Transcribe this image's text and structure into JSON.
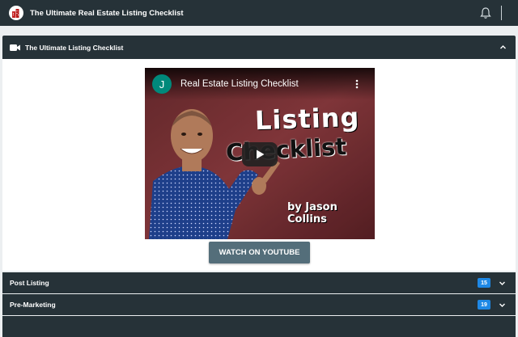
{
  "app": {
    "title": "The Ultimate Real Estate Listing Checklist",
    "logo_icon": "house-logo-icon"
  },
  "header_icons": [
    "bell-icon"
  ],
  "main_card": {
    "title": "The Ultimate Listing Checklist",
    "icon": "video-camera-icon",
    "expanded": true,
    "video": {
      "channel_initial": "J",
      "channel_color": "#00897b",
      "title": "Real Estate Listing Checklist",
      "thumb_line1": "Listing",
      "thumb_line2": "Checklist",
      "thumb_byline": "by Jason Collins"
    },
    "button_label": "WATCH ON YOUTUBE"
  },
  "sections": [
    {
      "label": "Post Listing",
      "count": "15"
    },
    {
      "label": "Pre-Marketing",
      "count": "19"
    }
  ],
  "colors": {
    "header_bg": "#263238",
    "page_bg": "#eceff1",
    "button_bg": "#546e7a",
    "badge_bg": "#1e88e5"
  }
}
